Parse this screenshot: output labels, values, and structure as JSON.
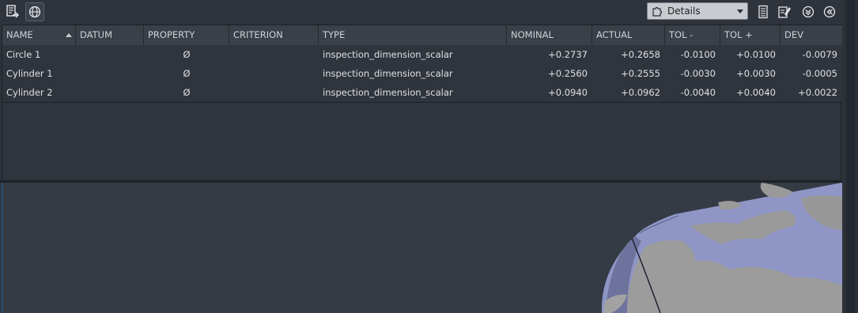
{
  "toolbar": {
    "export_icon": "export-report-icon",
    "globe_icon": "globe-icon",
    "view_selector": {
      "selected": "Details",
      "icon": "puzzle-icon"
    },
    "report_icon": "document-list-icon",
    "edit_icon": "edit-note-icon",
    "expand_icon": "expand-down-icon",
    "collapse_icon": "collapse-left-icon"
  },
  "table": {
    "columns": [
      "NAME",
      "DATUM",
      "PROPERTY",
      "CRITERION",
      "TYPE",
      "NOMINAL",
      "ACTUAL",
      "TOL -",
      "TOL +",
      "DEV"
    ],
    "sorted_column": "NAME",
    "rows": [
      {
        "name": "Circle 1",
        "datum": "",
        "property": "Ø",
        "criterion": "",
        "type": "inspection_dimension_scalar",
        "nominal": "+0.2737",
        "actual": "+0.2658",
        "tol_minus": "-0.0100",
        "tol_plus": "+0.0100",
        "dev": "-0.0079"
      },
      {
        "name": "Cylinder 1",
        "datum": "",
        "property": "Ø",
        "criterion": "",
        "type": "inspection_dimension_scalar",
        "nominal": "+0.2560",
        "actual": "+0.2555",
        "tol_minus": "-0.0030",
        "tol_plus": "+0.0030",
        "dev": "-0.0005"
      },
      {
        "name": "Cylinder 2",
        "datum": "",
        "property": "Ø",
        "criterion": "",
        "type": "inspection_dimension_scalar",
        "nominal": "+0.0940",
        "actual": "+0.0962",
        "tol_minus": "-0.0040",
        "tol_plus": "+0.0040",
        "dev": "+0.0022"
      }
    ]
  },
  "colors": {
    "panel_bg": "#30353d",
    "header_bg": "#3a4048",
    "viewport_bg": "#353b44",
    "part_surface": "#8e95c4",
    "scan_overlay": "#9a9a9a"
  }
}
